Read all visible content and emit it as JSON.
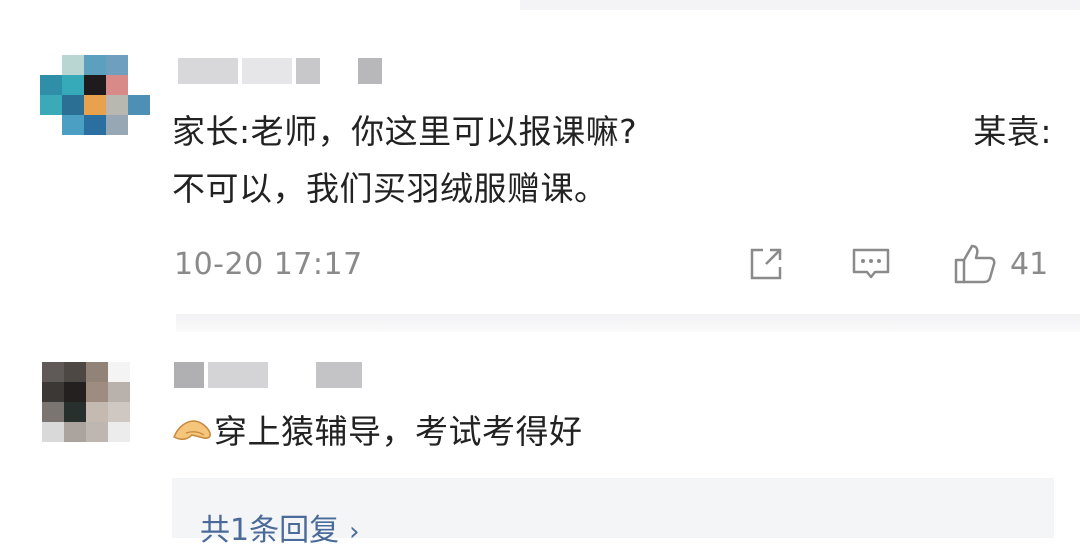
{
  "comments": [
    {
      "text_line1_left": "家长:老师，你这里可以报课嘛?",
      "text_line1_right": "某袁:",
      "text_line2": "不可以，我们买羽绒服赠课。",
      "time": "10-20 17:17",
      "likes": "41",
      "actions": {
        "share_icon": "share-icon",
        "reply_icon": "comment-icon",
        "like_icon": "thumbs-up-icon"
      }
    },
    {
      "emoji": "pointing-hand-emoji",
      "text": "穿上猿辅导，考试考得好",
      "replies_label": "共1条回复"
    }
  ],
  "colors": {
    "meta": "#8a8a8a",
    "text": "#222222",
    "link": "#4a6a9a",
    "reply_bg": "#f4f5f7"
  }
}
